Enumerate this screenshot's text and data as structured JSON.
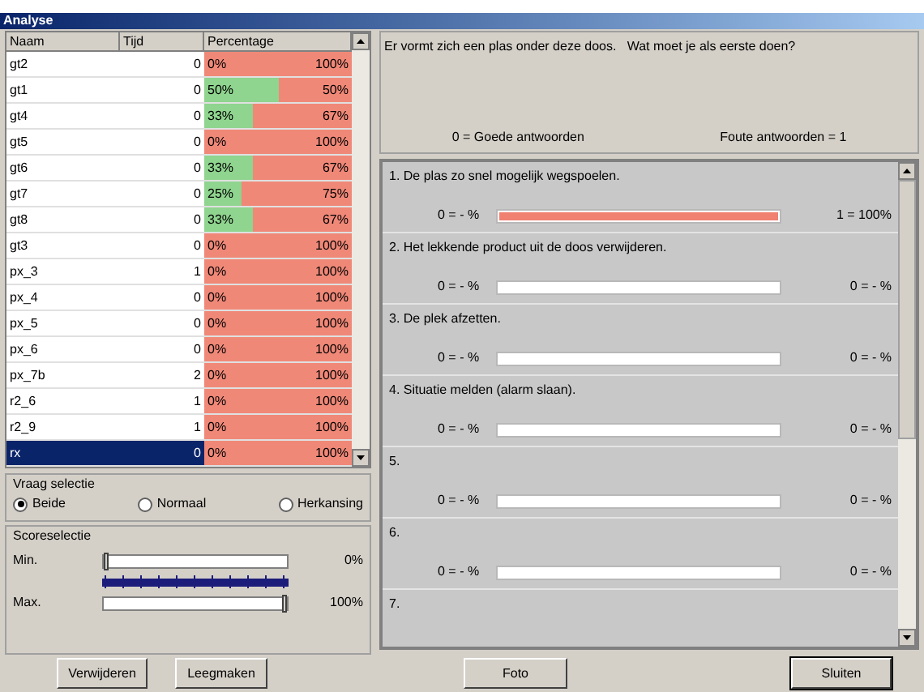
{
  "window": {
    "title": "Analyse"
  },
  "table": {
    "columns": [
      "Naam",
      "Tijd",
      "Percentage"
    ],
    "rows": [
      {
        "name": "gt2",
        "time": "0",
        "good": "0%",
        "wrong": "100%",
        "selected": false
      },
      {
        "name": "gt1",
        "time": "0",
        "good": "50%",
        "wrong": "50%",
        "level": 0.5,
        "selected": false
      },
      {
        "name": "gt4",
        "time": "0",
        "good": "33%",
        "wrong": "67%",
        "level": 0.33,
        "selected": false
      },
      {
        "name": "gt5",
        "time": "0",
        "good": "0%",
        "wrong": "100%",
        "selected": false
      },
      {
        "name": "gt6",
        "time": "0",
        "good": "33%",
        "wrong": "67%",
        "level": 0.33,
        "selected": false
      },
      {
        "name": "gt7",
        "time": "0",
        "good": "25%",
        "wrong": "75%",
        "level": 0.25,
        "selected": false
      },
      {
        "name": "gt8",
        "time": "0",
        "good": "33%",
        "wrong": "67%",
        "level": 0.33,
        "selected": false
      },
      {
        "name": "gt3",
        "time": "0",
        "good": "0%",
        "wrong": "100%",
        "selected": false
      },
      {
        "name": "px_3",
        "time": "1",
        "good": "0%",
        "wrong": "100%",
        "selected": false
      },
      {
        "name": "px_4",
        "time": "0",
        "good": "0%",
        "wrong": "100%",
        "selected": false
      },
      {
        "name": "px_5",
        "time": "0",
        "good": "0%",
        "wrong": "100%",
        "selected": false
      },
      {
        "name": "px_6",
        "time": "0",
        "good": "0%",
        "wrong": "100%",
        "selected": false
      },
      {
        "name": "px_7b",
        "time": "2",
        "good": "0%",
        "wrong": "100%",
        "selected": false
      },
      {
        "name": "r2_6",
        "time": "1",
        "good": "0%",
        "wrong": "100%",
        "selected": false
      },
      {
        "name": "r2_9",
        "time": "1",
        "good": "0%",
        "wrong": "100%",
        "selected": false
      },
      {
        "name": "rx",
        "time": "0",
        "good": "0%",
        "wrong": "100%",
        "selected": true
      }
    ]
  },
  "question_selection": {
    "title": "Vraag selectie",
    "options": [
      {
        "label": "Beide",
        "selected": true
      },
      {
        "label": "Normaal",
        "selected": false
      },
      {
        "label": "Herkansing",
        "selected": false
      }
    ]
  },
  "score_selection": {
    "title": "Scoreselectie",
    "sliders": [
      {
        "label": "Min.",
        "level": 0,
        "reading": "0%"
      },
      {
        "label": "Max.",
        "level": 1,
        "reading": "100%"
      }
    ]
  },
  "question": {
    "text": "Er vormt zich een plas onder deze doos.   Wat moet je als eerste doen?",
    "good": "0 = Goede antwoorden",
    "wrong": "Foute antwoorden = 1"
  },
  "answers": [
    {
      "text": "1.  De plas zo snel mogelijk wegspoelen.",
      "left": "0 = - %",
      "right": "1 = 100%",
      "level": 1
    },
    {
      "text": "2.  Het lekkende product uit de doos verwijderen.",
      "left": "0 = - %",
      "right": "0 = - %"
    },
    {
      "text": "3.  De plek afzetten.",
      "left": "0 = - %",
      "right": "0 = - %"
    },
    {
      "text": "4.  Situatie melden (alarm slaan).",
      "left": "0 = - %",
      "right": "0 = - %"
    },
    {
      "text": "5.",
      "left": "0 = - %",
      "right": "0 = - %"
    },
    {
      "text": "6.",
      "left": "0 = - %",
      "right": "0 = - %"
    },
    {
      "text": "7."
    }
  ],
  "buttons": [
    "Verwijderen",
    "Leegmaken",
    "Foto",
    "Sluiten"
  ]
}
